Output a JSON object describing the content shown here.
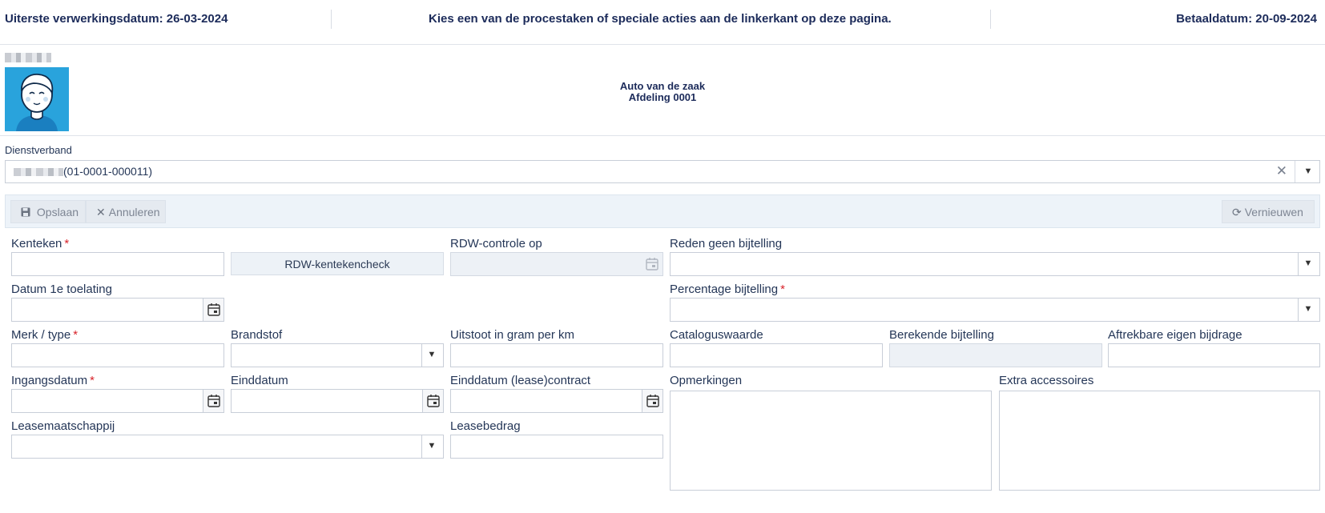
{
  "header": {
    "deadline": "Uiterste verwerkingsdatum: 26-03-2024",
    "instruction": "Kies een van de procestaken of speciale acties aan de linkerkant op deze pagina.",
    "paydate": "Betaaldatum: 20-09-2024"
  },
  "profile": {
    "title": "Auto van de zaak",
    "department": "Afdeling 0001"
  },
  "employment": {
    "label": "Dienstverband",
    "value": "(01-0001-000011)",
    "clear_icon": "close-icon",
    "dropdown_icon": "chevron-down-icon"
  },
  "toolbar": {
    "save_label": "Opslaan",
    "cancel_label": "Annuleren",
    "refresh_label": "Vernieuwen"
  },
  "form": {
    "kenteken": "Kenteken",
    "rdw_button": "RDW-kentekencheck",
    "rdw_controle": "RDW-controle op",
    "reden": "Reden geen bijtelling",
    "datum_toelating": "Datum 1e toelating",
    "percentage": "Percentage bijtelling",
    "merk": "Merk / type",
    "brandstof": "Brandstof",
    "uitstoot": "Uitstoot in gram per km",
    "cataloguswaarde": "Cataloguswaarde",
    "berekende": "Berekende bijtelling",
    "aftrekbare": "Aftrekbare eigen bijdrage",
    "ingangsdatum": "Ingangsdatum",
    "einddatum": "Einddatum",
    "einddatum_lease": "Einddatum (lease)contract",
    "opmerkingen": "Opmerkingen",
    "extra": "Extra accessoires",
    "leasemaatschappij": "Leasemaatschappij",
    "leasebedrag": "Leasebedrag",
    "required_mark": "*"
  },
  "colors": {
    "accent": "#29a3dc",
    "required": "#d8232a",
    "text": "#1c2b5a"
  }
}
